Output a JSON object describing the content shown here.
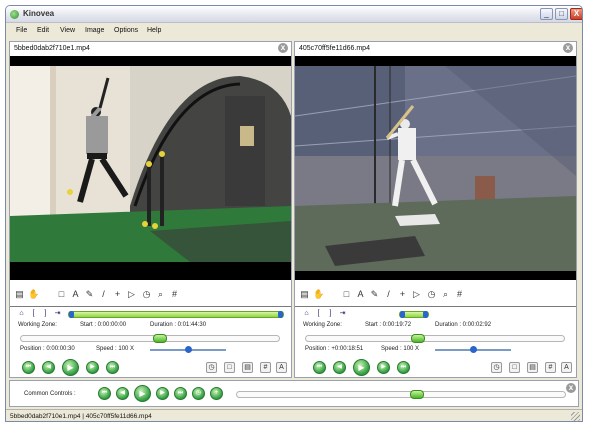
{
  "window": {
    "title": "Kinovea",
    "minimize": "_",
    "maximize": "□",
    "close": "X"
  },
  "menu": [
    "File",
    "Edit",
    "View",
    "Image",
    "Options",
    "Help"
  ],
  "players": [
    {
      "file": "5bbed0dab2f710e1.mp4",
      "close": "x",
      "working_zone_label": "Working Zone:",
      "start": "Start : 0:00:00:00",
      "duration": "Duration : 0:01:44:30",
      "position": "Position : 0:00:00:30",
      "speed": "Speed : 100 X",
      "pos_fraction": 0.54,
      "speed_fraction": 0.5
    },
    {
      "file": "405c70ff5fe11d66.mp4",
      "close": "x",
      "working_zone_label": "Working Zone:",
      "start": "Start : 0:00:19:72",
      "duration": "Duration : 0:00:02:92",
      "position": "Position : +0:00:18:51",
      "speed": "Speed : 100 X",
      "pos_fraction": 0.43,
      "speed_fraction": 0.5
    }
  ],
  "common": {
    "label": "Common Controls :",
    "close": "x",
    "pos_fraction": 0.55
  },
  "status": "5bbed0dab2f710e1.mp4 | 405c70ff5fe11d66.mp4",
  "icons": {
    "play": "▶",
    "prev": "◀",
    "first": "⏮",
    "next": "▶",
    "last": "⏭",
    "add": "+",
    "text": "A",
    "pencil": "✎",
    "line": "/",
    "cross": "+",
    "angle": "▷",
    "chrono": "◷",
    "magnifier": "⌕",
    "grid": "#",
    "note": "▤",
    "hand": "✋",
    "square": "□",
    "home": "⌂",
    "bracket_open": "[",
    "bracket_close": "]",
    "arrow": "⇥"
  }
}
